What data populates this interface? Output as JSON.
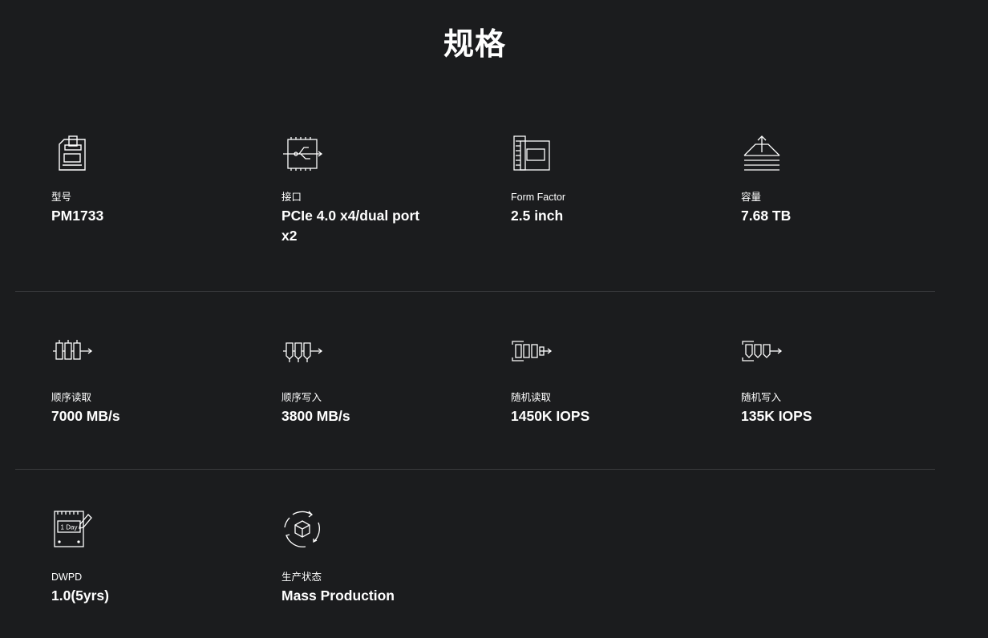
{
  "page": {
    "title": "规格"
  },
  "specs": [
    {
      "icon": "model-card-icon",
      "label": "型号",
      "value": "PM1733"
    },
    {
      "icon": "interface-chip-icon",
      "label": "接口",
      "value": "PCIe 4.0 x4/dual port x2"
    },
    {
      "icon": "form-factor-board-icon",
      "label": "Form Factor",
      "value": "2.5 inch"
    },
    {
      "icon": "capacity-stack-icon",
      "label": "容量",
      "value": "7.68 TB"
    },
    {
      "icon": "sequential-read-icon",
      "label": "顺序读取",
      "value": "7000 MB/s"
    },
    {
      "icon": "sequential-write-icon",
      "label": "顺序写入",
      "value": "3800 MB/s"
    },
    {
      "icon": "random-read-icon",
      "label": "随机读取",
      "value": "1450K IOPS"
    },
    {
      "icon": "random-write-icon",
      "label": "随机写入",
      "value": "135K IOPS"
    },
    {
      "icon": "dwpd-calendar-icon",
      "label": "DWPD",
      "value": "1.0(5yrs)",
      "icon_text": "1 Day"
    },
    {
      "icon": "production-status-icon",
      "label": "生产状态",
      "value": "Mass Production"
    }
  ]
}
